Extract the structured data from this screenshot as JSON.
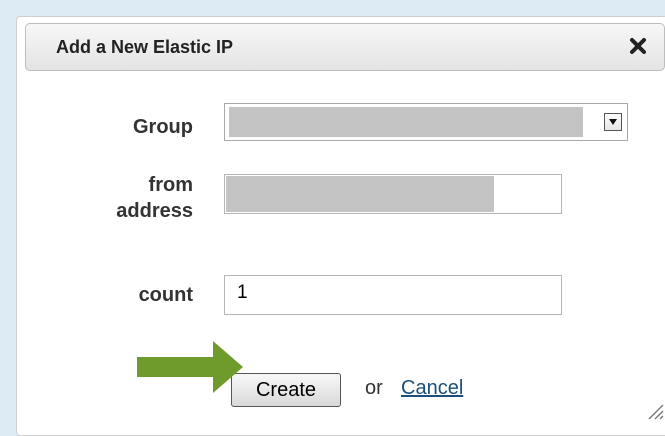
{
  "dialog": {
    "title": "Add a New Elastic IP",
    "close_icon": "close-icon"
  },
  "form": {
    "group_label": "Group",
    "group_value": "",
    "from_label_line1": "from",
    "from_label_line2": "address",
    "from_value": "",
    "count_label": "count",
    "count_value": "1"
  },
  "actions": {
    "create_label": "Create",
    "or_text": "or",
    "cancel_label": "Cancel"
  },
  "icons": {
    "dropdown": "chevron-down-icon",
    "annotation": "arrow-right-icon",
    "resize": "resize-grip-icon"
  },
  "colors": {
    "page_background": "#dcebf3",
    "arrow_green": "#6f9a2c",
    "redacted_fill": "#c3c3c3",
    "link": "#1a4f7a"
  }
}
